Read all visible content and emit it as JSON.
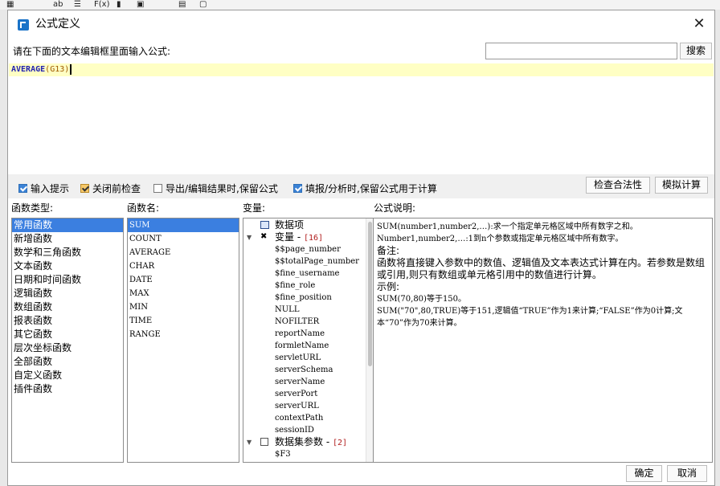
{
  "background": {
    "toolbar_icons": [
      "ab",
      "F(x)"
    ]
  },
  "dialog": {
    "title": "公式定义",
    "prompt": "请在下面的文本编辑框里面输入公式:",
    "search_value": "",
    "search_button": "搜索",
    "formula": {
      "fn": "AVERAGE",
      "open": "(",
      "arg": "G13",
      "close": ")"
    }
  },
  "options": {
    "input_hint": {
      "label": "输入提示",
      "checked": true
    },
    "check_before_close": {
      "label": "关闭前检查",
      "checked": true
    },
    "export_keep_formula": {
      "label": "导出/编辑结果时,保留公式",
      "checked": false
    },
    "fill_keep_formula": {
      "label": "填报/分析时,保留公式用于计算",
      "checked": true
    },
    "check_validity": "检查合法性",
    "simulate": "模拟计算"
  },
  "panels": {
    "types_label": "函数类型:",
    "names_label": "函数名:",
    "vars_label": "变量:",
    "desc_label": "公式说明:"
  },
  "function_types": [
    "常用函数",
    "新增函数",
    "数学和三角函数",
    "文本函数",
    "日期和时间函数",
    "逻辑函数",
    "数组函数",
    "报表函数",
    "其它函数",
    "层次坐标函数",
    "全部函数",
    "自定义函数",
    "插件函数"
  ],
  "function_names": [
    "SUM",
    "COUNT",
    "AVERAGE",
    "CHAR",
    "DATE",
    "MAX",
    "MIN",
    "TIME",
    "RANGE"
  ],
  "variables": {
    "data_item": "数据项",
    "var_group": "变量",
    "var_count": "[16]",
    "vars": [
      "$$page_number",
      "$$totalPage_number",
      "$fine_username",
      "$fine_role",
      "$fine_position",
      "NULL",
      "NOFILTER",
      "reportName",
      "formletName",
      "servletURL",
      "serverSchema",
      "serverName",
      "serverPort",
      "serverURL",
      "contextPath",
      "sessionID"
    ],
    "dataset_group": "数据集参数",
    "dataset_count": "[2]",
    "dataset_first": "$F3"
  },
  "description": [
    "SUM(number1,number2,…):求一个指定单元格区域中所有数字之和。",
    "Number1,number2,…:1到n个参数或指定单元格区域中所有数字。",
    "备注:",
    "函数将直接键入参数中的数值、逻辑值及文本表达式计算在内。若参数是数组或引用,则只有数组或单元格引用中的数值进行计算。",
    "示例:",
    "SUM(70,80)等于150。",
    "SUM(\"70\",80,TRUE)等于151,逻辑值“TRUE”作为1来计算;“FALSE”作为0计算;文本“70”作为70来计算。"
  ],
  "footer": {
    "ok": "确定",
    "cancel": "取消"
  },
  "colors": {
    "selection": "#3b7fe0",
    "editor_line": "#ffffc4",
    "function_name": "#2323b0"
  }
}
